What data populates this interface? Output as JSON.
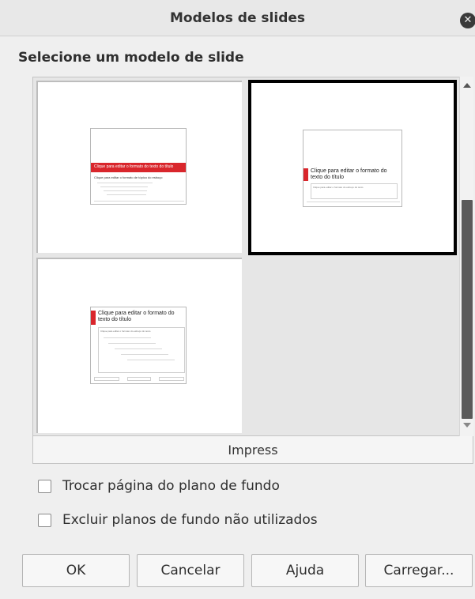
{
  "dialog": {
    "title": "Modelos de slides",
    "heading": "Selecione um modelo de slide"
  },
  "templates": [
    {
      "selected": false,
      "title_text": "Clique para editar o formato do texto do título",
      "body_text": "Clique para editar o formato de tópico do esboço"
    },
    {
      "selected": true,
      "title_text": "Clique para editar o formato do texto do título",
      "body_text": "Clique para editar o formato do esboço do texto"
    },
    {
      "selected": false,
      "title_text": "Clique para editar o formato do texto do título",
      "body_text": "Clique para editar o formato do esboço do texto"
    }
  ],
  "category_label": "Impress",
  "options": {
    "swap_background": {
      "label": "Trocar página do plano de fundo",
      "checked": false
    },
    "delete_unused": {
      "label": "Excluir planos de fundo não utilizados",
      "checked": false
    }
  },
  "buttons": {
    "ok": "OK",
    "cancel": "Cancelar",
    "help": "Ajuda",
    "load": "Carregar..."
  },
  "colors": {
    "accent_red": "#d9262c",
    "selection_border": "#000000"
  }
}
